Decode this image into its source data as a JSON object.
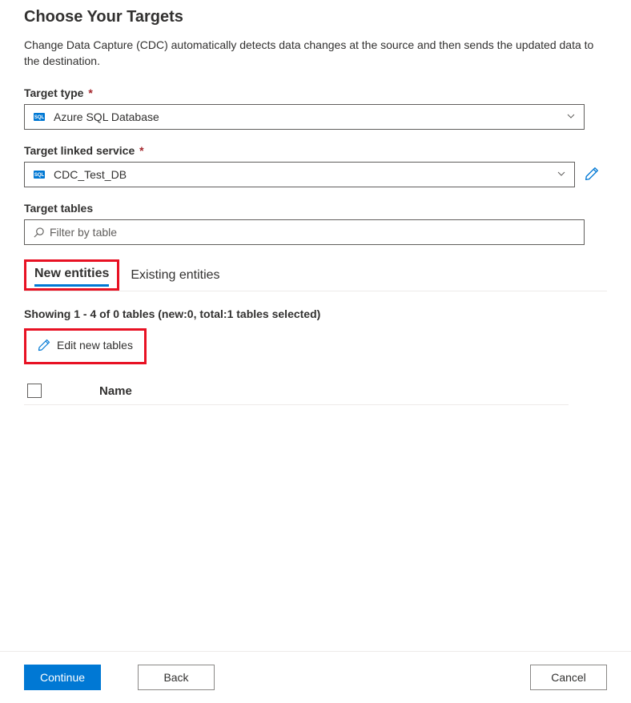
{
  "header": {
    "title": "Choose Your Targets",
    "subtitle": "Change Data Capture (CDC) automatically detects data changes at the source and then sends the updated data to the destination."
  },
  "fields": {
    "targetType": {
      "label": "Target type",
      "value": "Azure SQL Database"
    },
    "linkedService": {
      "label": "Target linked service",
      "value": "CDC_Test_DB"
    },
    "targetTables": {
      "label": "Target tables",
      "placeholder": "Filter by table"
    }
  },
  "tabs": {
    "new": "New entities",
    "existing": "Existing entities"
  },
  "tableInfo": {
    "summary": "Showing 1 - 4 of 0 tables (new:0, total:1 tables selected)",
    "editButton": "Edit new tables",
    "columnName": "Name"
  },
  "footer": {
    "continue": "Continue",
    "back": "Back",
    "cancel": "Cancel"
  }
}
